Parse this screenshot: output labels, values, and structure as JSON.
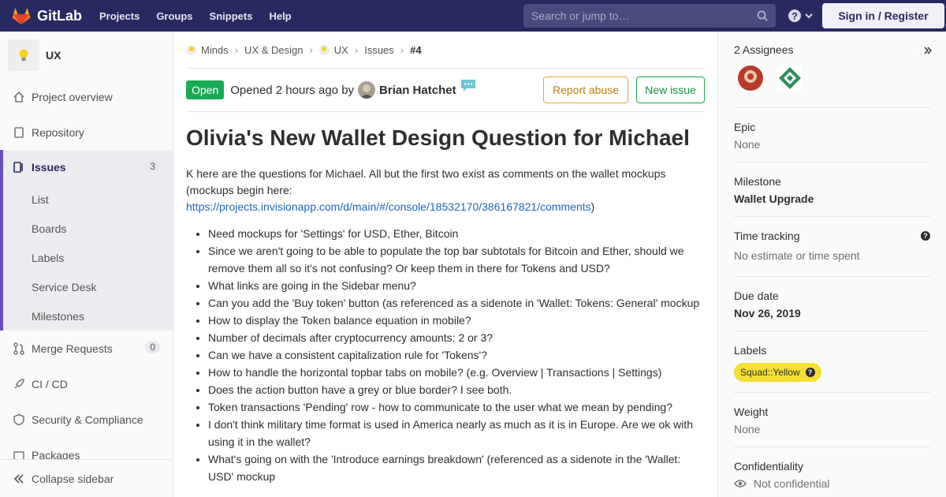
{
  "navbar": {
    "brand": "GitLab",
    "links": [
      "Projects",
      "Groups",
      "Snippets",
      "Help"
    ],
    "search_placeholder": "Search or jump to…",
    "signin_label": "Sign in / Register"
  },
  "sidebar": {
    "project_name": "UX",
    "items": [
      {
        "label": "Project overview",
        "icon": "home-icon"
      },
      {
        "label": "Repository",
        "icon": "book-icon"
      },
      {
        "label": "Issues",
        "icon": "issues-icon",
        "count": "3"
      },
      {
        "label": "Merge Requests",
        "icon": "merge-request-icon",
        "count": "0"
      },
      {
        "label": "CI / CD",
        "icon": "rocket-icon"
      },
      {
        "label": "Security & Compliance",
        "icon": "shield-icon"
      },
      {
        "label": "Packages",
        "icon": "package-icon"
      }
    ],
    "issue_subitems": [
      "List",
      "Boards",
      "Labels",
      "Service Desk",
      "Milestones"
    ],
    "collapse_label": "Collapse sidebar"
  },
  "breadcrumb": {
    "items": [
      "Minds",
      "UX & Design",
      "UX",
      "Issues"
    ],
    "current": "#4"
  },
  "issue": {
    "status": "Open",
    "opened_text": "Opened 2 hours ago by",
    "author": "Brian Hatchet",
    "report_abuse_label": "Report abuse",
    "new_issue_label": "New issue",
    "title": "Olivia's New Wallet Design Question for Michael",
    "intro": "K here are the questions for Michael. All but the first two exist as comments on the wallet mockups (mockups begin here:",
    "link": "https://projects.invisionapp.com/d/main/#/console/18532170/386167821/comments",
    "link_close": ")",
    "questions": [
      "Need mockups for 'Settings' for USD, Ether, Bitcoin",
      "Since we aren't going to be able to populate the top bar subtotals for Bitcoin and Ether, should we remove them all so it's not confusing? Or keep them in there for Tokens and USD?",
      "What links are going in the Sidebar menu?",
      "Can you add the 'Buy token' button (as referenced as a sidenote in 'Wallet: Tokens: General' mockup",
      "How to display the Token balance equation in mobile?",
      "Number of decimals after cryptocurrency amounts: 2 or 3?",
      "Can we have a consistent capitalization rule for 'Tokens'?",
      "How to handle the horizontal topbar tabs on mobile? (e.g. Overview | Transactions | Settings)",
      "Does the action button have a grey or blue border? I see both.",
      "Token transactions 'Pending' row - how to communicate to the user what we mean by pending?",
      "I don't think military time format is used in America nearly as much as it is in Europe. Are we ok with using it in the wallet?",
      "What's going on with the 'Introduce earnings breakdown' (referenced as a sidenote in the 'Wallet: USD' mockup"
    ]
  },
  "right_sidebar": {
    "assignees_title": "2 Assignees",
    "epic_title": "Epic",
    "epic_value": "None",
    "milestone_title": "Milestone",
    "milestone_value": "Wallet Upgrade",
    "time_title": "Time tracking",
    "time_value": "No estimate or time spent",
    "due_title": "Due date",
    "due_value": "Nov 26, 2019",
    "labels_title": "Labels",
    "label_value": "Squad::Yellow",
    "label_color": "#f3e032",
    "weight_title": "Weight",
    "weight_value": "None",
    "conf_title": "Confidentiality",
    "conf_value": "Not confidential"
  },
  "colors": {
    "navbar": "#292961",
    "accent": "#6b4fbb",
    "open_status": "#1aaa55",
    "link": "#1b69b6"
  }
}
